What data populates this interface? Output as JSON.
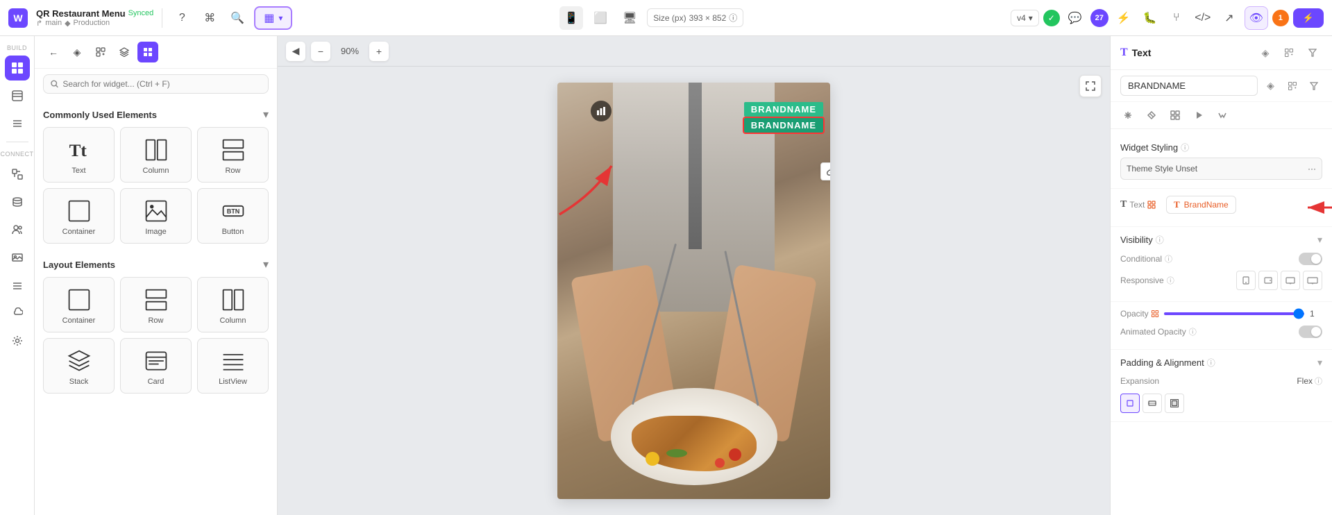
{
  "app": {
    "logo": "W",
    "project_name": "QR Restaurant Menu",
    "synced_label": "Synced",
    "branch": "main",
    "env": "Production"
  },
  "topbar": {
    "help_icon": "?",
    "keyboard_icon": "⌘",
    "search_icon": "🔍",
    "active_tool_label": "▦",
    "device_mobile": "📱",
    "device_tablet": "⬜",
    "device_desktop": "🖥",
    "size_label": "Size (px)",
    "size_value": "393 × 852",
    "info_icon": "ⓘ",
    "version": "v4",
    "chevron": "▾",
    "publish_label": "⚡",
    "notifications_count": "27",
    "badge_1": "1"
  },
  "left_nav": {
    "items": [
      {
        "id": "widget",
        "icon": "⊞",
        "label": "Build",
        "active": true
      },
      {
        "id": "layers",
        "icon": "☰"
      },
      {
        "id": "data",
        "icon": "⊟"
      },
      {
        "id": "connect",
        "icon": "⊡",
        "label": "Connect"
      },
      {
        "id": "db",
        "icon": "▦"
      },
      {
        "id": "pages",
        "icon": "⬡"
      },
      {
        "id": "users",
        "icon": "👥"
      },
      {
        "id": "images",
        "icon": "🖼"
      },
      {
        "id": "nav",
        "icon": "☰"
      },
      {
        "id": "plugins",
        "icon": "☁"
      },
      {
        "id": "settings",
        "icon": "⚙"
      }
    ]
  },
  "widget_panel": {
    "toolbar_items": [
      {
        "id": "back",
        "icon": "←"
      },
      {
        "id": "gem",
        "icon": "◈"
      },
      {
        "id": "add",
        "icon": "+"
      },
      {
        "id": "layers",
        "icon": "⊞"
      },
      {
        "id": "build",
        "icon": "⊞",
        "active": true
      }
    ],
    "search_placeholder": "Search for widget... (Ctrl + F)",
    "commonly_used_title": "Commonly Used Elements",
    "layout_elements_title": "Layout Elements",
    "common_widgets": [
      {
        "id": "text",
        "label": "Text",
        "icon": "text"
      },
      {
        "id": "column",
        "label": "Column",
        "icon": "column"
      },
      {
        "id": "row",
        "label": "Row",
        "icon": "row"
      },
      {
        "id": "container",
        "label": "Container",
        "icon": "container"
      },
      {
        "id": "image",
        "label": "Image",
        "icon": "image"
      },
      {
        "id": "button",
        "label": "Button",
        "icon": "button"
      }
    ],
    "layout_widgets": [
      {
        "id": "container2",
        "label": "Container",
        "icon": "container"
      },
      {
        "id": "row2",
        "label": "Row",
        "icon": "row"
      },
      {
        "id": "column2",
        "label": "Column",
        "icon": "column"
      },
      {
        "id": "stack",
        "label": "Stack",
        "icon": "stack"
      },
      {
        "id": "card",
        "label": "Card",
        "icon": "card"
      },
      {
        "id": "listview",
        "label": "ListView",
        "icon": "listview"
      }
    ]
  },
  "canvas": {
    "zoom": "90%",
    "brandname_1": "BRANDNAME",
    "brandname_2": "BRANDNAME"
  },
  "right_panel": {
    "title": "Text",
    "text_icon": "T",
    "brandname_value": "BRANDNAME",
    "tabs": [
      {
        "id": "styling",
        "icon": "✕",
        "active": false
      },
      {
        "id": "data",
        "icon": "↕"
      },
      {
        "id": "table",
        "icon": "▦"
      },
      {
        "id": "play",
        "icon": "▶"
      },
      {
        "id": "event",
        "icon": "⚡"
      }
    ],
    "widget_styling_label": "Widget Styling",
    "info_icon": "ⓘ",
    "theme_style_label": "Theme Style Unset",
    "text_section_label": "Text",
    "brandname_chip_label": "BrandName",
    "visibility_label": "Visibility",
    "conditional_label": "Conditional",
    "responsive_label": "Responsive",
    "opacity_label": "Opacity",
    "opacity_value": "1",
    "animated_opacity_label": "Animated Opacity",
    "padding_alignment_label": "Padding & Alignment",
    "expansion_label": "Expansion",
    "flex_label": "Flex"
  }
}
